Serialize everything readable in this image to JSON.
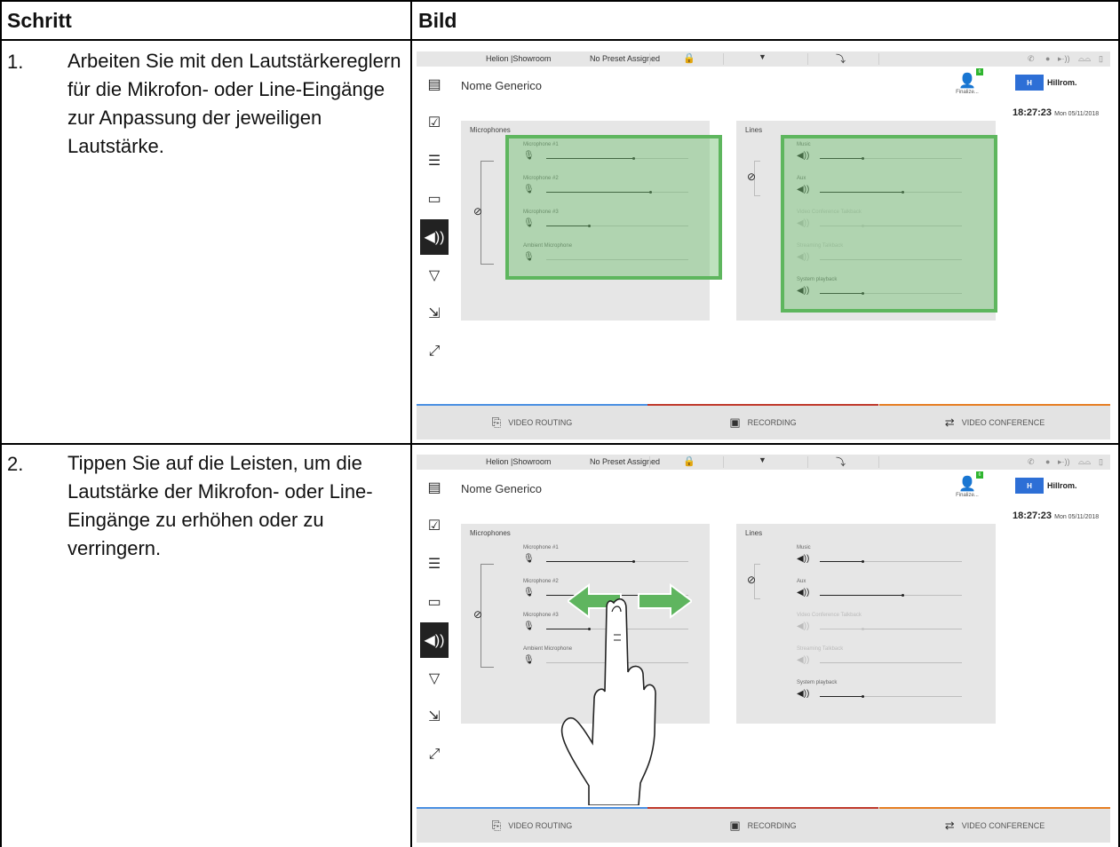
{
  "table": {
    "col_step": "Schritt",
    "col_image": "Bild",
    "rows": [
      {
        "num": "1.",
        "text": "Arbeiten Sie mit den Lautstärkereglern für die Mikrofon- oder Line-Eingänge zur Anpassung der jeweiligen Lautstärke."
      },
      {
        "num": "2.",
        "text": "Tippen Sie auf die Leisten, um die Lautstärke der Mikrofon- oder Line-Eingänge zu erhöhen oder zu verringern."
      }
    ]
  },
  "ui": {
    "topbar": {
      "location": "Helion |Showroom",
      "preset": "No Preset Assigned"
    },
    "title": "Nome Generico",
    "finalize": "Finalize...",
    "badge": "6",
    "brand": "Hillrom.",
    "logo_mark": "H",
    "time": "18:27:23",
    "date": "Mon 05/11/2018",
    "microphones_title": "Microphones",
    "lines_title": "Lines",
    "microphones": [
      {
        "label": "Microphone #1",
        "level": 0.61
      },
      {
        "label": "Microphone #2",
        "level": 0.73
      },
      {
        "label": "Microphone #3",
        "level": 0.3
      },
      {
        "label": "Ambient Microphone",
        "level": 0.0
      }
    ],
    "lines": [
      {
        "label": "Music",
        "level": 0.3,
        "enabled": true
      },
      {
        "label": "Aux",
        "level": 0.58,
        "enabled": true
      },
      {
        "label": "Video Conference Talkback",
        "level": 0.3,
        "enabled": false
      },
      {
        "label": "Streaming Talkback",
        "level": 0.0,
        "enabled": false
      },
      {
        "label": "System playback",
        "level": 0.3,
        "enabled": true
      }
    ],
    "tabs": [
      {
        "label": "VIDEO ROUTING",
        "color": "#4a90e2",
        "icon": "video-routing-icon"
      },
      {
        "label": "RECORDING",
        "color": "#c0392b",
        "icon": "recording-icon"
      },
      {
        "label": "VIDEO CONFERENCE",
        "color": "#e67e22",
        "icon": "video-conference-icon"
      }
    ],
    "highlight_color": "#5eb65e"
  }
}
